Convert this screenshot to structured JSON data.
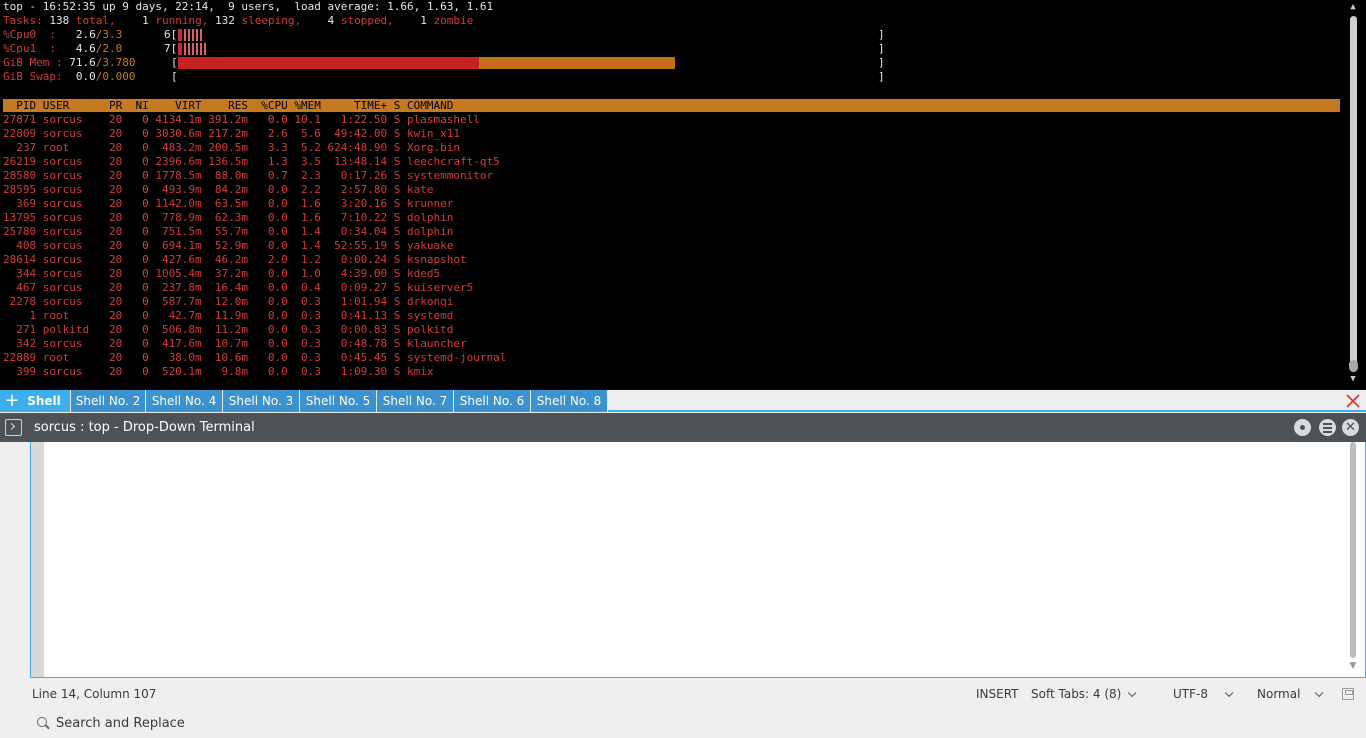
{
  "terminal": {
    "summary": "top - 16:52:35 up 9 days, 22:14,  9 users,  load average: 1.66, 1.63, 1.61",
    "tasks_prefix": "Tasks:",
    "tasks_total": " 138",
    "tasks_total_label": " total,",
    "tasks_running": "    1",
    "tasks_running_label": " running,",
    "tasks_sleeping": " 132",
    "tasks_sleeping_label": " sleeping,",
    "tasks_stopped": "    4",
    "tasks_stopped_label": " stopped,",
    "tasks_zombie": "    1",
    "tasks_zombie_label": " zombie",
    "cpu0_label": "%Cpu0  :",
    "cpu0_a": "   2.6",
    "cpu0_b": "/3.3",
    "cpu0_num": "6[",
    "cpu1_label": "%Cpu1  :",
    "cpu1_a": "   4.6",
    "cpu1_b": "/2.0",
    "cpu1_num": "7[",
    "mem_label": "GiB Mem :",
    "mem_a": " 71.6",
    "mem_b": "/3.780",
    "mem_bracket": "[",
    "mem_used_fraction": 0.43,
    "mem_buff_fraction": 0.28,
    "swap_label": "GiB Swap:",
    "swap_a": "  0.0",
    "swap_b": "/0.000",
    "swap_bracket": "[",
    "close_bracket": "]",
    "header": "  PID USER      PR  NI    VIRT    RES  %CPU %MEM     TIME+ S COMMAND",
    "processes": [
      "27871 sorcus    20   0 4134.1m 391.2m   0.0 10.1   1:22.50 S plasmashell",
      "22809 sorcus    20   0 3030.6m 217.2m   2.6  5.6  49:42.00 S kwin_x11",
      "  237 root      20   0  483.2m 200.5m   3.3  5.2 624:48.90 S Xorg.bin",
      "26219 sorcus    20   0 2396.6m 136.5m   1.3  3.5  13:48.14 S leechcraft-qt5",
      "28580 sorcus    20   0 1778.5m  88.0m   0.7  2.3   0:17.26 S systemmonitor",
      "28595 sorcus    20   0  493.9m  84.2m   0.0  2.2   2:57.80 S kate",
      "  369 sorcus    20   0 1142.0m  63.5m   0.0  1.6   3:20.16 S krunner",
      "13795 sorcus    20   0  778.9m  62.3m   0.0  1.6   7:10.22 S dolphin",
      "25780 sorcus    20   0  751.5m  55.7m   0.0  1.4   0:34.04 S dolphin",
      "  408 sorcus    20   0  694.1m  52.9m   0.0  1.4  52:55.19 S yakuake",
      "28614 sorcus    20   0  427.6m  46.2m   2.0  1.2   0:00.24 S ksnapshot",
      "  344 sorcus    20   0 1005.4m  37.2m   0.0  1.0   4:39.00 S kded5",
      "  467 sorcus    20   0  237.8m  16.4m   0.0  0.4   0:09.27 S kuiserver5",
      " 2278 sorcus    20   0  587.7m  12.0m   0.0  0.3   1:01.94 S drkonqi",
      "    1 root      20   0   42.7m  11.9m   0.0  0.3   0:41.13 S systemd",
      "  271 polkitd   20   0  506.8m  11.2m   0.0  0.3   0:00.83 S polkitd",
      "  342 sorcus    20   0  417.6m  10.7m   0.0  0.3   0:48.78 S klauncher",
      "22889 root      20   0   38.0m  10.6m   0.0  0.3   0:45.45 S systemd-journal",
      "  399 sorcus    20   0  520.1m   9.8m   0.0  0.3   1:09.30 S kmix"
    ]
  },
  "tabs": [
    "Shell",
    "Shell No. 2",
    "Shell No. 4",
    "Shell No. 3",
    "Shell No. 5",
    "Shell No. 7",
    "Shell No. 6",
    "Shell No. 8"
  ],
  "window": {
    "title": "sorcus : top - Drop-Down Terminal"
  },
  "status": {
    "position": "Line 14, Column 107",
    "mode": "INSERT",
    "tabs": "Soft Tabs: 4 (8)",
    "encoding": "UTF-8",
    "highlight": "Normal"
  },
  "search": {
    "label": "Search and Replace"
  },
  "colors": {
    "accent": "#3daee9",
    "terminal_red": "#d23a3a",
    "terminal_orange": "#c57a22"
  },
  "icons": {
    "new_tab": "plus-icon",
    "close_tab": "close-icon",
    "terminal": "terminal-icon",
    "keep_above": "keep-above-icon",
    "menu": "hamburger-icon",
    "close_window": "close-icon",
    "save": "save-icon",
    "search": "search-icon"
  }
}
